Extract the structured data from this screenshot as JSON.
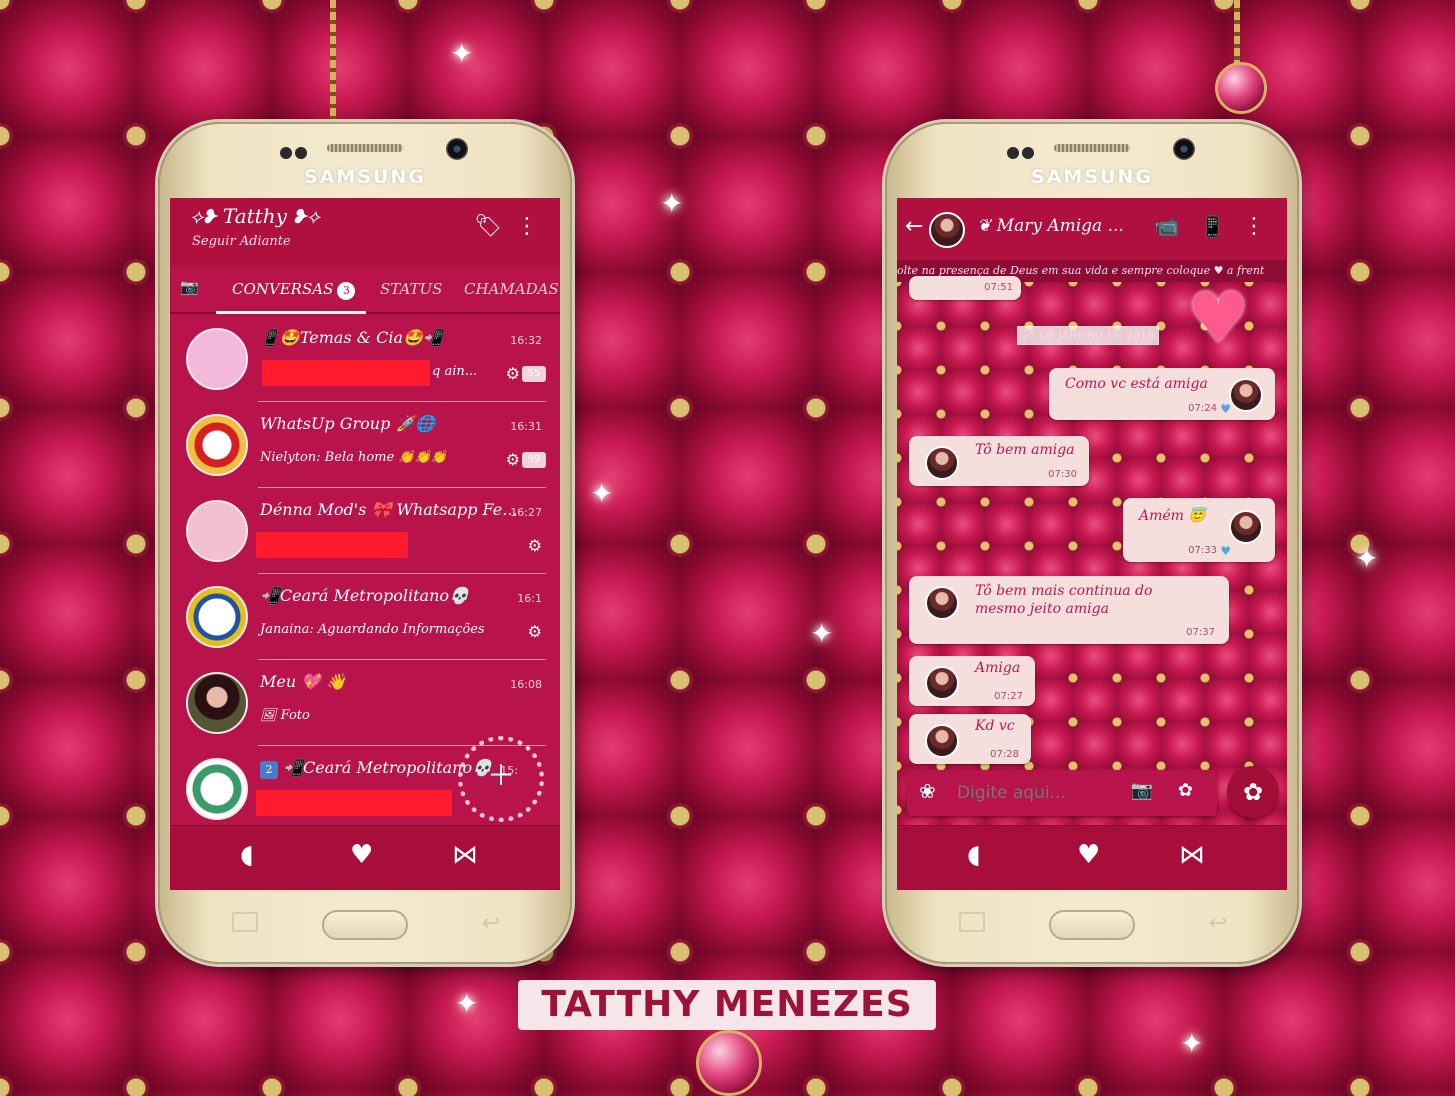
{
  "colors": {
    "primary": "#b8134a",
    "dark": "#8d0b34",
    "bubble": "#f4dfdc",
    "redaction": "#ff1a2e"
  },
  "phone_brand": "SAMSUNG",
  "left": {
    "header": {
      "title": "Tatthy",
      "subtitle": "Seguir Adiante"
    },
    "tabs": [
      {
        "label": "CONVERSAS",
        "badge": "3"
      },
      {
        "label": "STATUS"
      },
      {
        "label": "CHAMADAS"
      }
    ],
    "chats": [
      {
        "name": "📱🤩Temas & Cia🤩📲",
        "time": "16:32",
        "message": "q ain...",
        "count": "55"
      },
      {
        "name": "WhatsUp Group 🚀🌐",
        "time": "16:31",
        "message": "Nielyton: Bela home 👏👏👏",
        "count": "99"
      },
      {
        "name": "Dénna Mod's 🎀 Whatsapp Fe...",
        "time": "16:27",
        "message": "",
        "count": ""
      },
      {
        "name": "📲Ceará Metropolitano💀",
        "time": "16:1",
        "message": "Janaina: Aguardando Informações",
        "count": ""
      },
      {
        "name": "Meu 💖 👋",
        "time": "16:08",
        "message": "Foto",
        "count": ""
      },
      {
        "name": "📲Ceará Metropolitano💀",
        "time": "15:",
        "message": "",
        "count": "2"
      }
    ],
    "nav_icons": [
      "chat-icon",
      "heart-icon",
      "candy-icon"
    ]
  },
  "right": {
    "header": {
      "contact": "Mary Amiga ..."
    },
    "marquee": "olte na presença de Deus em sua vida e sempre coloque ♥ a frent",
    "date_chip": "25 DE JANEIRO DE 2018",
    "top_time": "07:51",
    "messages": [
      {
        "dir": "out",
        "text": "Como vc está amiga",
        "time": "07:24"
      },
      {
        "dir": "in",
        "text": "Tô bem amiga",
        "time": "07:30"
      },
      {
        "dir": "out",
        "text": "Amém 😇",
        "time": "07:33"
      },
      {
        "dir": "in",
        "text": "Tô bem mais continua do mesmo jeito amiga",
        "time": "07:37"
      },
      {
        "dir": "in",
        "text": "Amiga",
        "time": "07:27"
      },
      {
        "dir": "in",
        "text": "Kd vc",
        "time": "07:28"
      }
    ],
    "compose_placeholder": "Digite aqui...",
    "nav_icons": [
      "chat-icon",
      "heart-icon",
      "candy-icon"
    ]
  },
  "credit": "TATTHY MENEZES"
}
